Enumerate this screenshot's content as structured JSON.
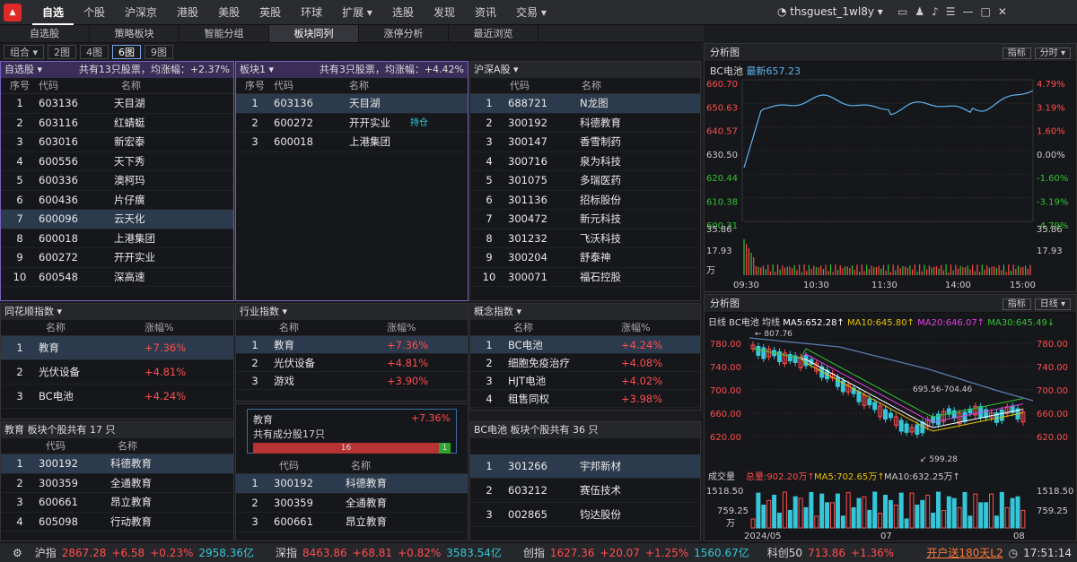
{
  "app": {
    "logo": "同花顺",
    "nav": [
      "自选",
      "个股",
      "沪深京",
      "港股",
      "美股",
      "英股",
      "环球",
      "扩展 ▾",
      "选股",
      "发现",
      "资讯",
      "交易 ▾"
    ],
    "user": "thsguest_1wl8y"
  },
  "tabs2": [
    "自选股",
    "策略板块",
    "智能分组",
    "板块同列",
    "涨停分析",
    "最近浏览"
  ],
  "tabs3": [
    "组合 ▾",
    "2图",
    "4图",
    "6图",
    "9图"
  ],
  "p1": {
    "title": "自选股 ▾",
    "summary": "共有13只股票，均涨幅：+2.37%",
    "cols": [
      "序号",
      "代码",
      "名称"
    ],
    "rows": [
      [
        "1",
        "603136",
        "天目湖"
      ],
      [
        "2",
        "603116",
        "红蜻蜓"
      ],
      [
        "3",
        "603016",
        "新宏泰"
      ],
      [
        "4",
        "600556",
        "天下秀"
      ],
      [
        "5",
        "600336",
        "澳柯玛"
      ],
      [
        "6",
        "600436",
        "片仔癀"
      ],
      [
        "7",
        "600096",
        "云天化"
      ],
      [
        "8",
        "600018",
        "上港集团"
      ],
      [
        "9",
        "600272",
        "开开实业"
      ],
      [
        "10",
        "600548",
        "深高速"
      ]
    ]
  },
  "p2": {
    "title": "板块1 ▾",
    "summary": "共有3只股票，均涨幅：+4.42%",
    "cols": [
      "序号",
      "代码",
      "名称"
    ],
    "rows": [
      [
        "1",
        "603136",
        "天目湖"
      ],
      [
        "2",
        "600272",
        "开开实业"
      ],
      [
        "3",
        "600018",
        "上港集团"
      ]
    ],
    "badge": "持仓"
  },
  "p3": {
    "title": "沪深A股 ▾",
    "cols": [
      "代码",
      "名称"
    ],
    "rows": [
      [
        "1",
        "688721",
        "N龙图"
      ],
      [
        "2",
        "300192",
        "科德教育"
      ],
      [
        "3",
        "300147",
        "香雪制药"
      ],
      [
        "4",
        "300716",
        "泉为科技"
      ],
      [
        "5",
        "301075",
        "多瑞医药"
      ],
      [
        "6",
        "301136",
        "招标股份"
      ],
      [
        "7",
        "300472",
        "新元科技"
      ],
      [
        "8",
        "301232",
        "飞沃科技"
      ],
      [
        "9",
        "300204",
        "舒泰神"
      ],
      [
        "10",
        "300071",
        "福石控股"
      ]
    ]
  },
  "p4": {
    "title": "同花顺指数 ▾",
    "cols": [
      "名称",
      "涨幅%"
    ],
    "rows": [
      [
        "1",
        "教育",
        "+7.36%"
      ],
      [
        "2",
        "光伏设备",
        "+4.81%"
      ],
      [
        "3",
        "BC电池",
        "+4.24%"
      ]
    ]
  },
  "p5": {
    "title": "行业指数 ▾",
    "cols": [
      "名称",
      "涨幅%"
    ],
    "rows": [
      [
        "1",
        "教育",
        "+7.36%"
      ],
      [
        "2",
        "光伏设备",
        "+4.81%"
      ],
      [
        "3",
        "游戏",
        "+3.90%"
      ]
    ]
  },
  "p6": {
    "title": "概念指数 ▾",
    "cols": [
      "名称",
      "涨幅%"
    ],
    "rows": [
      [
        "1",
        "BC电池",
        "+4.24%"
      ],
      [
        "2",
        "细胞免疫治疗",
        "+4.08%"
      ],
      [
        "3",
        "HJT电池",
        "+4.02%"
      ],
      [
        "4",
        "租售同权",
        "+3.98%"
      ]
    ]
  },
  "p7": {
    "title": "教育  板块个股共有 17 只",
    "cols": [
      "代码",
      "名称"
    ],
    "rows": [
      [
        "1",
        "300192",
        "科德教育"
      ],
      [
        "2",
        "300359",
        "全通教育"
      ],
      [
        "3",
        "600661",
        "昂立教育"
      ],
      [
        "4",
        "605098",
        "行动教育"
      ]
    ]
  },
  "p8": {
    "card_name": "教育",
    "card_pct": "+7.36%",
    "card_text": "共有成分股17只",
    "up": "16",
    "down": "1",
    "cols": [
      "代码",
      "名称"
    ],
    "rows": [
      [
        "1",
        "300192",
        "科德教育"
      ],
      [
        "2",
        "300359",
        "全通教育"
      ],
      [
        "3",
        "600661",
        "昂立教育"
      ]
    ]
  },
  "p9": {
    "title": "BC电池  板块个股共有 36 只",
    "rows": [
      [
        "1",
        "301266",
        "宇邦新材"
      ],
      [
        "2",
        "603212",
        "赛伍技术"
      ],
      [
        "3",
        "002865",
        "钧达股份"
      ]
    ]
  },
  "intraday": {
    "title": "分析图",
    "name": "BC电池",
    "latest": "最新657.23",
    "btns": [
      "指标",
      "分时 ▾"
    ],
    "ylabels": [
      "660.70",
      "650.63",
      "640.57",
      "630.50",
      "620.44",
      "610.38",
      "600.31"
    ],
    "pct": [
      "4.79%",
      "3.19%",
      "1.60%",
      "0.00%",
      "-1.60%",
      "-3.19%",
      "-4.79%"
    ],
    "vol": [
      "35.86",
      "17.93",
      "万"
    ],
    "times": [
      "09:30",
      "10:30",
      "11:30",
      "14:00",
      "15:00"
    ]
  },
  "daily": {
    "title": "分析图",
    "label": "日线  BC电池",
    "ma": [
      "均线",
      "MA5:652.28↑",
      "MA10:645.80↑",
      "MA20:646.07↑",
      "MA30:645.49↓"
    ],
    "btns": [
      "指标",
      "日线 ▾"
    ],
    "ylabels": [
      "780.00",
      "740.00",
      "700.00",
      "660.00",
      "620.00"
    ],
    "hi": "807.76",
    "lo": "599.28",
    "mid": "695.56-704.46",
    "vol_title": "成交量",
    "vol_vals": [
      "总量:902.20万↑",
      "MA5:702.65万↑",
      "MA10:632.25万↑"
    ],
    "vol_y": [
      "1518.50",
      "759.25",
      "万"
    ],
    "dates": [
      "2024/05",
      "07",
      "08"
    ]
  },
  "status": {
    "items": [
      [
        "沪指",
        "2867.28",
        "+6.58",
        "+0.23%",
        "2958.36亿"
      ],
      [
        "深指",
        "8463.86",
        "+68.81",
        "+0.82%",
        "3583.54亿"
      ],
      [
        "创指",
        "1627.36",
        "+20.07",
        "+1.25%",
        "1560.67亿"
      ],
      [
        "科创50",
        "713.86",
        "+1.36%"
      ]
    ],
    "promo": "开户送180天L2",
    "time": "17:51:14"
  },
  "colors": {
    "up": "#ff4d4d",
    "down": "#2fc52f",
    "accent": "#7a5fc0"
  }
}
